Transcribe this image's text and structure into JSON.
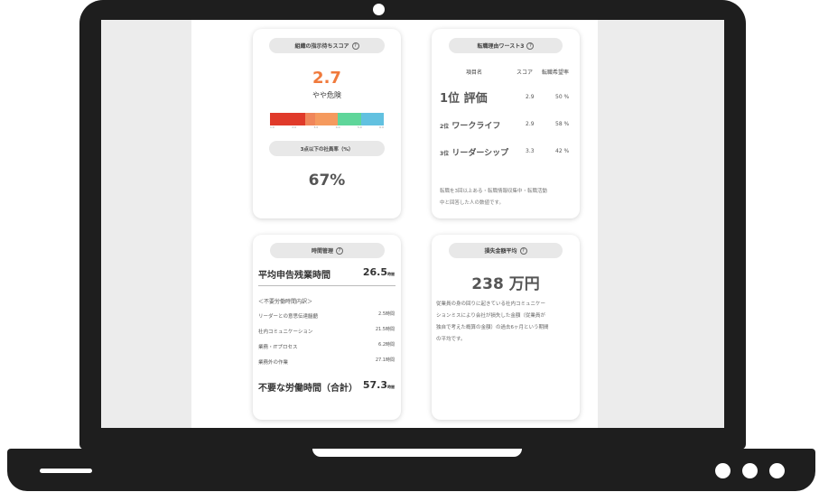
{
  "colors": {
    "accent": "#f07a3c",
    "bar": [
      "#e03a2a",
      "#f0865a",
      "#f59a5e",
      "#5fd69a",
      "#62c1e0"
    ]
  },
  "card1": {
    "title": "組織の指示待ちスコア",
    "help_icon": "?",
    "score": "2.7",
    "score_label": "やや危険",
    "scale_ticks": [
      "1.0",
      "2.0",
      "3.0",
      "4.0",
      "5.0",
      "6.0"
    ],
    "sub_title": "3点以下の社員率（%）",
    "percent": "67%"
  },
  "card2": {
    "title": "転職理由ワースト3",
    "help_icon": "?",
    "headers": {
      "name": "項目名",
      "score": "スコア",
      "rate": "転職希望率"
    },
    "rows": [
      {
        "rank": "1位",
        "name": "評価",
        "score": "2.9",
        "rate": "50 %"
      },
      {
        "rank": "2位",
        "name": "ワークライフ",
        "score": "2.9",
        "rate": "58 %"
      },
      {
        "rank": "3位",
        "name": "リーダーシップ",
        "score": "3.3",
        "rate": "42 %"
      }
    ],
    "note_line1": "転職を3回以上ある・転職情報収集中・転職活動",
    "note_line2": "中と回答した人の数値です。"
  },
  "card3": {
    "title": "時間管理",
    "help_icon": "?",
    "main_label": "平均申告残業時間",
    "main_value": "26.5",
    "main_unit": "時間",
    "section_label": "＜不要労働時間内訳＞",
    "items": [
      {
        "label": "リーダーとの意思伝達齟齬",
        "value": "2.5時間"
      },
      {
        "label": "社内コミュニケーション",
        "value": "21.5時間"
      },
      {
        "label": "業務・ITプロセス",
        "value": "6.2時間"
      },
      {
        "label": "業務外の作業",
        "value": "27.1時間"
      }
    ],
    "total_label": "不要な労働時間（合計）",
    "total_value": "57.3",
    "total_unit": "時間"
  },
  "card4": {
    "title": "損失金額平均",
    "help_icon": "?",
    "amount": "238 万円",
    "desc_line1": "従業員の身の回りに起きている社内コミュニケー",
    "desc_line2": "ションミスにより会社が損失した金額（従業員が",
    "desc_line3": "独自で考えた概算の金額）の過去6ヶ月という期間",
    "desc_line4": "の平均です。"
  }
}
